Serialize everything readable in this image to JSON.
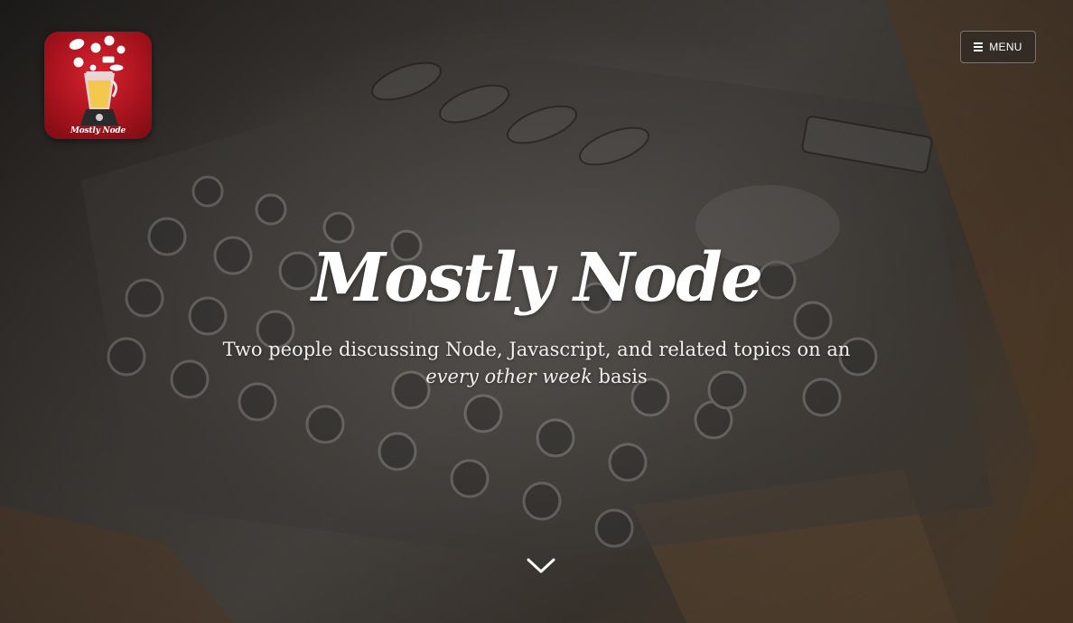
{
  "site": {
    "logo_text": "Mostly Node",
    "title": "Mostly Node",
    "tagline_start": "Two people discussing Node, Javascript, and related topics on an ",
    "tagline_emphasis": "every other week",
    "tagline_end": " basis"
  },
  "header": {
    "menu_label": "MENU",
    "menu_icon": "hamburger-icon"
  },
  "scroll": {
    "icon": "chevron-down-icon"
  },
  "colors": {
    "logo_red": "#c8182a",
    "text": "#ffffff"
  }
}
